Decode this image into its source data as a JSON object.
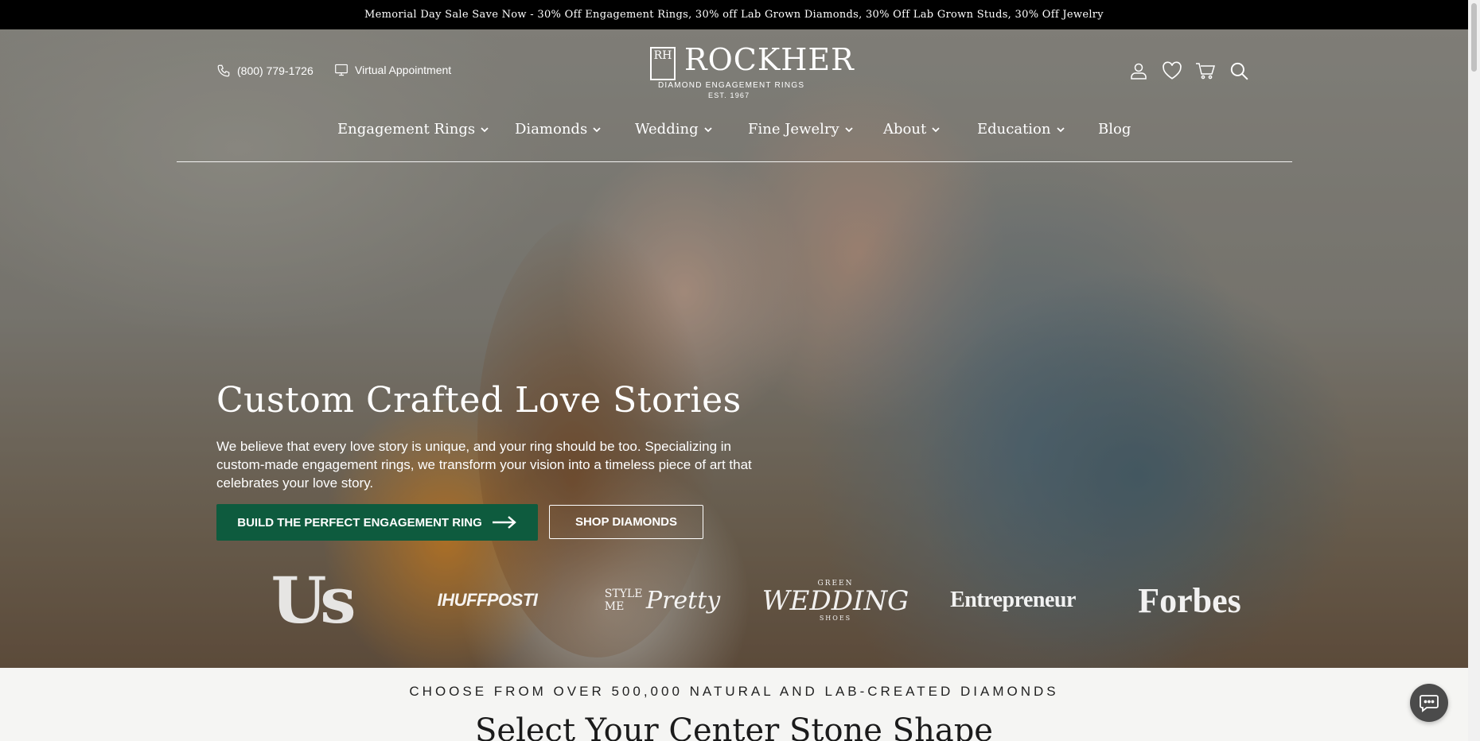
{
  "promo": {
    "text": "Memorial Day Sale Save Now - 30% Off Engagement Rings, 30% off Lab Grown Diamonds, 30% Off Lab Grown Studs, 30% Off Jewelry"
  },
  "header": {
    "phone": "(800) 779-1726",
    "virtual_appointment": "Virtual Appointment",
    "logo": {
      "mark": "RH",
      "word": "ROCKHER",
      "tagline": "DIAMOND ENGAGEMENT RINGS",
      "est": "EST. 1967"
    },
    "icons": [
      "account-icon",
      "heart-icon",
      "cart-icon",
      "search-icon"
    ]
  },
  "nav": {
    "items": [
      {
        "label": "Engagement Rings"
      },
      {
        "label": "Diamonds"
      },
      {
        "label": "Wedding"
      },
      {
        "label": "Fine Jewelry"
      },
      {
        "label": "About"
      },
      {
        "label": "Education"
      },
      {
        "label": "Blog"
      }
    ]
  },
  "hero": {
    "title": "Custom Crafted Love Stories",
    "body": "We believe that every love story is unique, and your ring should be too. Specializing in custom-made engagement rings, we transform your vision into a timeless piece of art that celebrates your love story.",
    "primary_cta": "BUILD THE PERFECT ENGAGEMENT RING",
    "secondary_cta": "SHOP DIAMONDS"
  },
  "press": {
    "us": "Us",
    "huffpost": "IHUFFPOSTI",
    "style_me_pretty_a": "STYLE ME",
    "style_me_pretty_b": "Pretty",
    "green_wedding_a": "GREEN",
    "green_wedding_b": "WEDDING",
    "green_wedding_c": "SHOES",
    "entrepreneur": "Entrepreneur",
    "forbes": "Forbes"
  },
  "section": {
    "eyebrow": "CHOOSE FROM OVER 500,000 NATURAL AND LAB-CREATED DIAMONDS",
    "title": "Select Your Center Stone Shape"
  },
  "colors": {
    "promo_bg": "#000000",
    "cta_green": "#0e5b3e",
    "chat_bg": "#4b4b4b"
  }
}
